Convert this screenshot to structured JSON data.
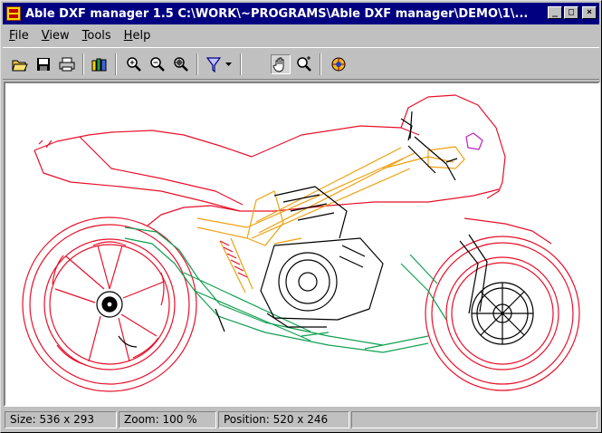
{
  "window": {
    "title": "Able DXF manager 1.5 C:\\WORK\\~PROGRAMS\\Able DXF manager\\DEMO\\1\\..."
  },
  "caption_buttons": {
    "minimize": "_",
    "maximize": "□",
    "close": "×"
  },
  "menu": [
    {
      "label": "File",
      "accel": "F",
      "rest": "ile"
    },
    {
      "label": "View",
      "accel": "V",
      "rest": "iew"
    },
    {
      "label": "Tools",
      "accel": "T",
      "rest": "ools"
    },
    {
      "label": "Help",
      "accel": "H",
      "rest": "elp"
    }
  ],
  "toolbar": {
    "buttons": [
      "open-icon",
      "save-icon",
      "print-icon",
      "layers-icon",
      "zoom-in-icon",
      "zoom-out-icon",
      "zoom-extents-icon",
      "filter-icon",
      "dropdown-arrow-icon",
      "pan-hand-icon",
      "zoom-window-icon",
      "render-icon"
    ],
    "pressed": "pan-hand-icon"
  },
  "drawing": {
    "colors": {
      "body": "#e8102a",
      "frame": "#f0a010",
      "chassis": "#10a050",
      "engine": "#000000",
      "accent": "#c020c0"
    }
  },
  "status": {
    "size": "Size: 536 x 293",
    "zoom": "Zoom: 100 %",
    "position": "Position: 520 x 246"
  }
}
